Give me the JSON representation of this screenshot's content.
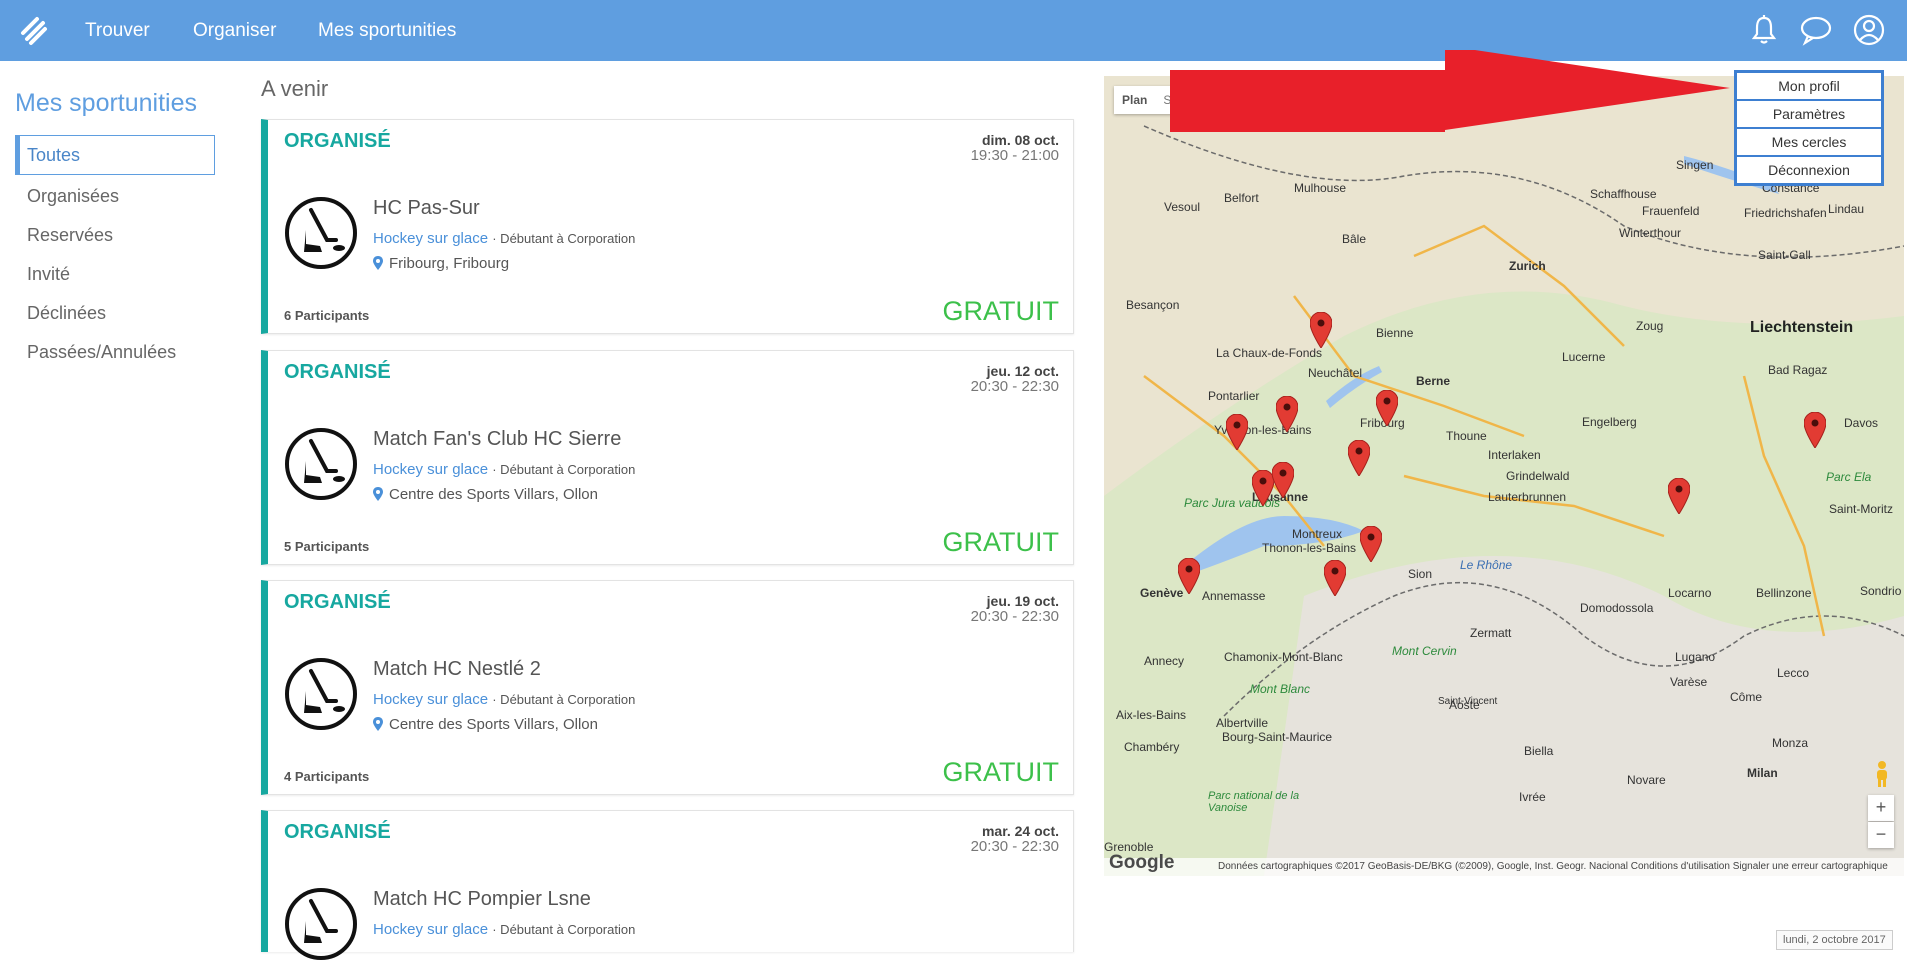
{
  "nav": {
    "items": [
      "Trouver",
      "Organiser",
      "Mes sportunities"
    ]
  },
  "sidebar": {
    "title": "Mes sportunities",
    "items": [
      "Toutes",
      "Organisées",
      "Reservées",
      "Invité",
      "Déclinées",
      "Passées/Annulées"
    ]
  },
  "main": {
    "section_title": "A venir",
    "events": [
      {
        "status": "ORGANISÉ",
        "day": "dim. 08 oct.",
        "time": "19:30 - 21:00",
        "name": "HC Pas-Sur",
        "sport": "Hockey sur glace",
        "level": "· Débutant à Corporation",
        "location": "Fribourg, Fribourg",
        "participants": "6 Participants",
        "price": "GRATUIT"
      },
      {
        "status": "ORGANISÉ",
        "day": "jeu. 12 oct.",
        "time": "20:30 - 22:30",
        "name": "Match Fan's Club HC Sierre",
        "sport": "Hockey sur glace",
        "level": "· Débutant à Corporation",
        "location": "Centre des Sports Villars, Ollon",
        "participants": "5 Participants",
        "price": "GRATUIT"
      },
      {
        "status": "ORGANISÉ",
        "day": "jeu. 19 oct.",
        "time": "20:30 - 22:30",
        "name": "Match HC Nestlé 2",
        "sport": "Hockey sur glace",
        "level": "· Débutant à Corporation",
        "location": "Centre des Sports Villars, Ollon",
        "participants": "4 Participants",
        "price": "GRATUIT"
      },
      {
        "status": "ORGANISÉ",
        "day": "mar. 24 oct.",
        "time": "20:30 - 22:30",
        "name": "Match HC Pompier Lsne",
        "sport": "Hockey sur glace",
        "level": "· Débutant à Corporation",
        "location": "",
        "participants": "",
        "price": ""
      }
    ]
  },
  "map": {
    "toggle": [
      "Plan",
      "Sa"
    ],
    "google": "Google",
    "footer": "Données cartographiques ©2017 GeoBasis-DE/BKG (©2009), Google, Inst. Geogr. Nacional    Conditions d'utilisation    Signaler une erreur cartographique",
    "labels": [
      "Mulhouse",
      "Bâle",
      "Zurich",
      "Belfort",
      "Besançon",
      "Bienne",
      "Berne",
      "Neuchâtel",
      "La Chaux-de-Fonds",
      "Pontarlier",
      "Fribourg",
      "Lucerne",
      "Zoug",
      "Liechtenstein",
      "Davos",
      "Lausanne",
      "Montreux",
      "Genève",
      "Annemasse",
      "Sion",
      "Thoune",
      "Interlaken",
      "Lugano",
      "Locarno",
      "Annecy",
      "Chambéry",
      "Milan",
      "Côme",
      "Aoste",
      "Zermatt",
      "Mont Blanc",
      "Mont Cervin",
      "Parc Jura vaudois",
      "Vesoul",
      "Schaffhouse",
      "Winterthour",
      "Saint-Gall",
      "Constance",
      "Frauenfeld",
      "Bellinzone",
      "Varèse",
      "Novare",
      "Biella",
      "Ivrée",
      "Albertville",
      "Aix-les-Bains",
      "Chamonix-Mont-Blanc",
      "Thonon-les-Bains",
      "Yverdon-les-Bains",
      "Lauterbrunnen",
      "Grindelwald",
      "Domodossola",
      "Lecco",
      "Monza",
      "Parc Ela",
      "Saint-Moritz",
      "Bad Ragaz",
      "Engelberg",
      "Le Rhône",
      "Grenoble",
      "Lindau",
      "Friedrichshafen",
      "Singen",
      "Sondrio",
      "Saint-Vincent",
      "Bourg-Saint-Maurice",
      "Parc national de la Vanoise"
    ],
    "zoom_in": "+",
    "zoom_out": "−"
  },
  "profile_menu": {
    "items": [
      "Mon profil",
      "Paramètres",
      "Mes cercles",
      "Déconnexion"
    ]
  },
  "footer_date": "lundi, 2 octobre 2017",
  "colors": {
    "topbar": "#5f9ee0",
    "accent_teal": "#17a8a0",
    "price_green": "#3cc04a",
    "annotation_arrow": "#e8202a"
  }
}
